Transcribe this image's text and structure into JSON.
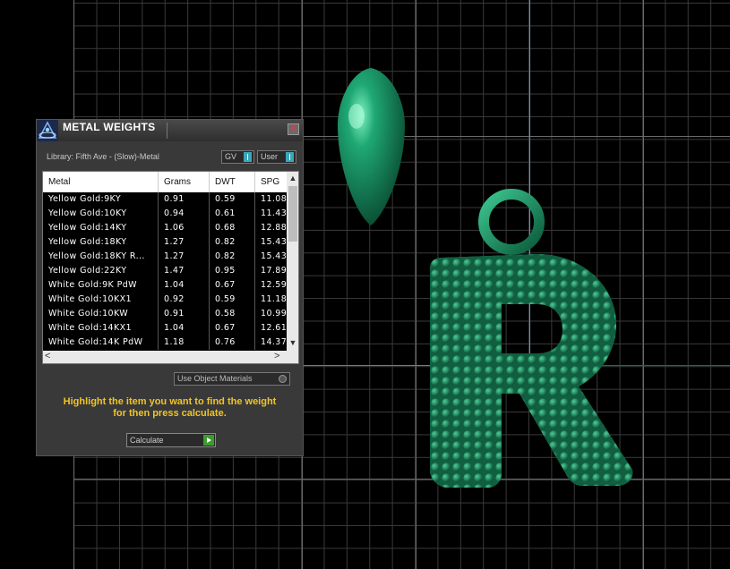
{
  "dialog": {
    "title": "METAL WEIGHTS",
    "close_label": "✕",
    "library_label": "Library: Fifth Ave - (Slow)-Metal",
    "gv_label": "GV",
    "user_label": "User",
    "use_materials_label": "Use Object Materials",
    "instructions_line1": "Highlight the item you want to find the weight",
    "instructions_line2": "for then press calculate.",
    "calculate_label": "Calculate"
  },
  "table": {
    "columns": [
      "Metal",
      "Grams",
      "DWT",
      "SPG"
    ],
    "rows": [
      [
        "Yellow Gold:9KY",
        "0.91",
        "0.59",
        "11.08"
      ],
      [
        "Yellow Gold:10KY",
        "0.94",
        "0.61",
        "11.43"
      ],
      [
        "Yellow Gold:14KY",
        "1.06",
        "0.68",
        "12.88"
      ],
      [
        "Yellow Gold:18KY",
        "1.27",
        "0.82",
        "15.43"
      ],
      [
        "Yellow Gold:18KY R...",
        "1.27",
        "0.82",
        "15.43"
      ],
      [
        "Yellow Gold:22KY",
        "1.47",
        "0.95",
        "17.89"
      ],
      [
        "White Gold:9K PdW",
        "1.04",
        "0.67",
        "12.59"
      ],
      [
        "White Gold:10KX1",
        "0.92",
        "0.59",
        "11.18"
      ],
      [
        "White Gold:10KW",
        "0.91",
        "0.58",
        "10.99"
      ],
      [
        "White Gold:14KX1",
        "1.04",
        "0.67",
        "12.61"
      ],
      [
        "White Gold:14K PdW",
        "1.18",
        "0.76",
        "14.37"
      ]
    ]
  },
  "scroll": {
    "up": "▲",
    "down": "▼",
    "left": "<",
    "right": ">"
  },
  "scene": {
    "model_color": "#1d8a5c",
    "axis_x_color": "#c0202a",
    "axis_y_color": "#3aa7c7"
  },
  "icons": {
    "app": "app-logo-icon",
    "close": "close-icon",
    "go": "play-icon"
  }
}
